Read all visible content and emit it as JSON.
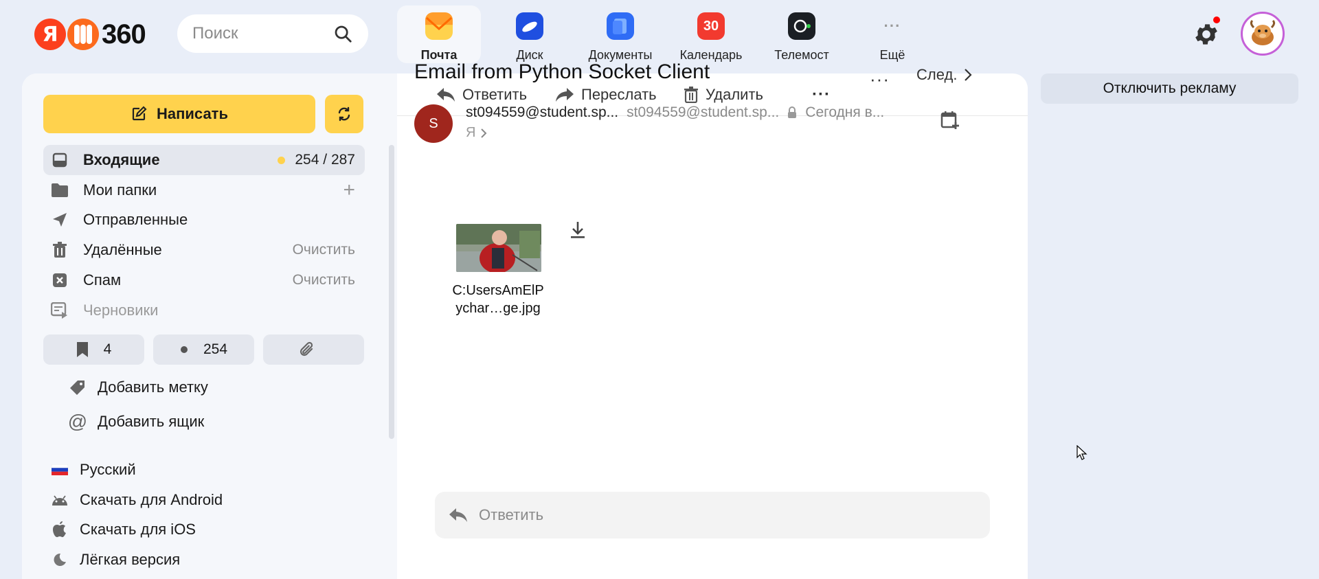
{
  "header": {
    "logo": {
      "letter": "Я",
      "number": "360"
    },
    "search_placeholder": "Поиск",
    "services": [
      {
        "label": "Почта",
        "icon": "mail-icon",
        "active": true
      },
      {
        "label": "Диск",
        "icon": "disk-icon"
      },
      {
        "label": "Документы",
        "icon": "documents-icon"
      },
      {
        "label": "Календарь",
        "icon": "calendar-icon",
        "badge": "30"
      },
      {
        "label": "Телемост",
        "icon": "telemost-icon"
      },
      {
        "label": "Ещё",
        "icon": "more-icon"
      }
    ]
  },
  "sidebar": {
    "compose_label": "Написать",
    "folders": {
      "inbox": {
        "label": "Входящие",
        "unread": "254",
        "total": "287",
        "separator": "/"
      },
      "my_folders": {
        "label": "Мои папки"
      },
      "sent": {
        "label": "Отправленные"
      },
      "deleted": {
        "label": "Удалённые",
        "action": "Очистить"
      },
      "spam": {
        "label": "Спам",
        "action": "Очистить"
      },
      "drafts": {
        "label": "Черновики"
      }
    },
    "chips": {
      "bookmarks": "4",
      "unread": "254"
    },
    "add_label": "Добавить метку",
    "add_mailbox": "Добавить ящик",
    "footer": {
      "language": "Русский",
      "android": "Скачать для Android",
      "ios": "Скачать для iOS",
      "lite": "Лёгкая версия"
    }
  },
  "toolbar": {
    "reply": "Ответить",
    "forward": "Переслать",
    "delete": "Удалить",
    "more": "···"
  },
  "message": {
    "subject": "Email from Python Socket Client",
    "more": "···",
    "next": "След.",
    "sender_initial": "S",
    "sender_name": "st094559@student.sp...",
    "sender_email": "st094559@student.sp...",
    "sent_time": "Сегодня в...",
    "recipient": "Я",
    "attachment": {
      "line1": "C:UsersAmElP",
      "line2": "ychar…ge.jpg"
    },
    "reply_placeholder": "Ответить"
  },
  "ads": {
    "disable_label": "Отключить рекламу"
  },
  "colors": {
    "accent": "#ffd24d",
    "background": "#e9eef8",
    "sender_avatar": "#a0261d",
    "notification": "#ff0000"
  }
}
